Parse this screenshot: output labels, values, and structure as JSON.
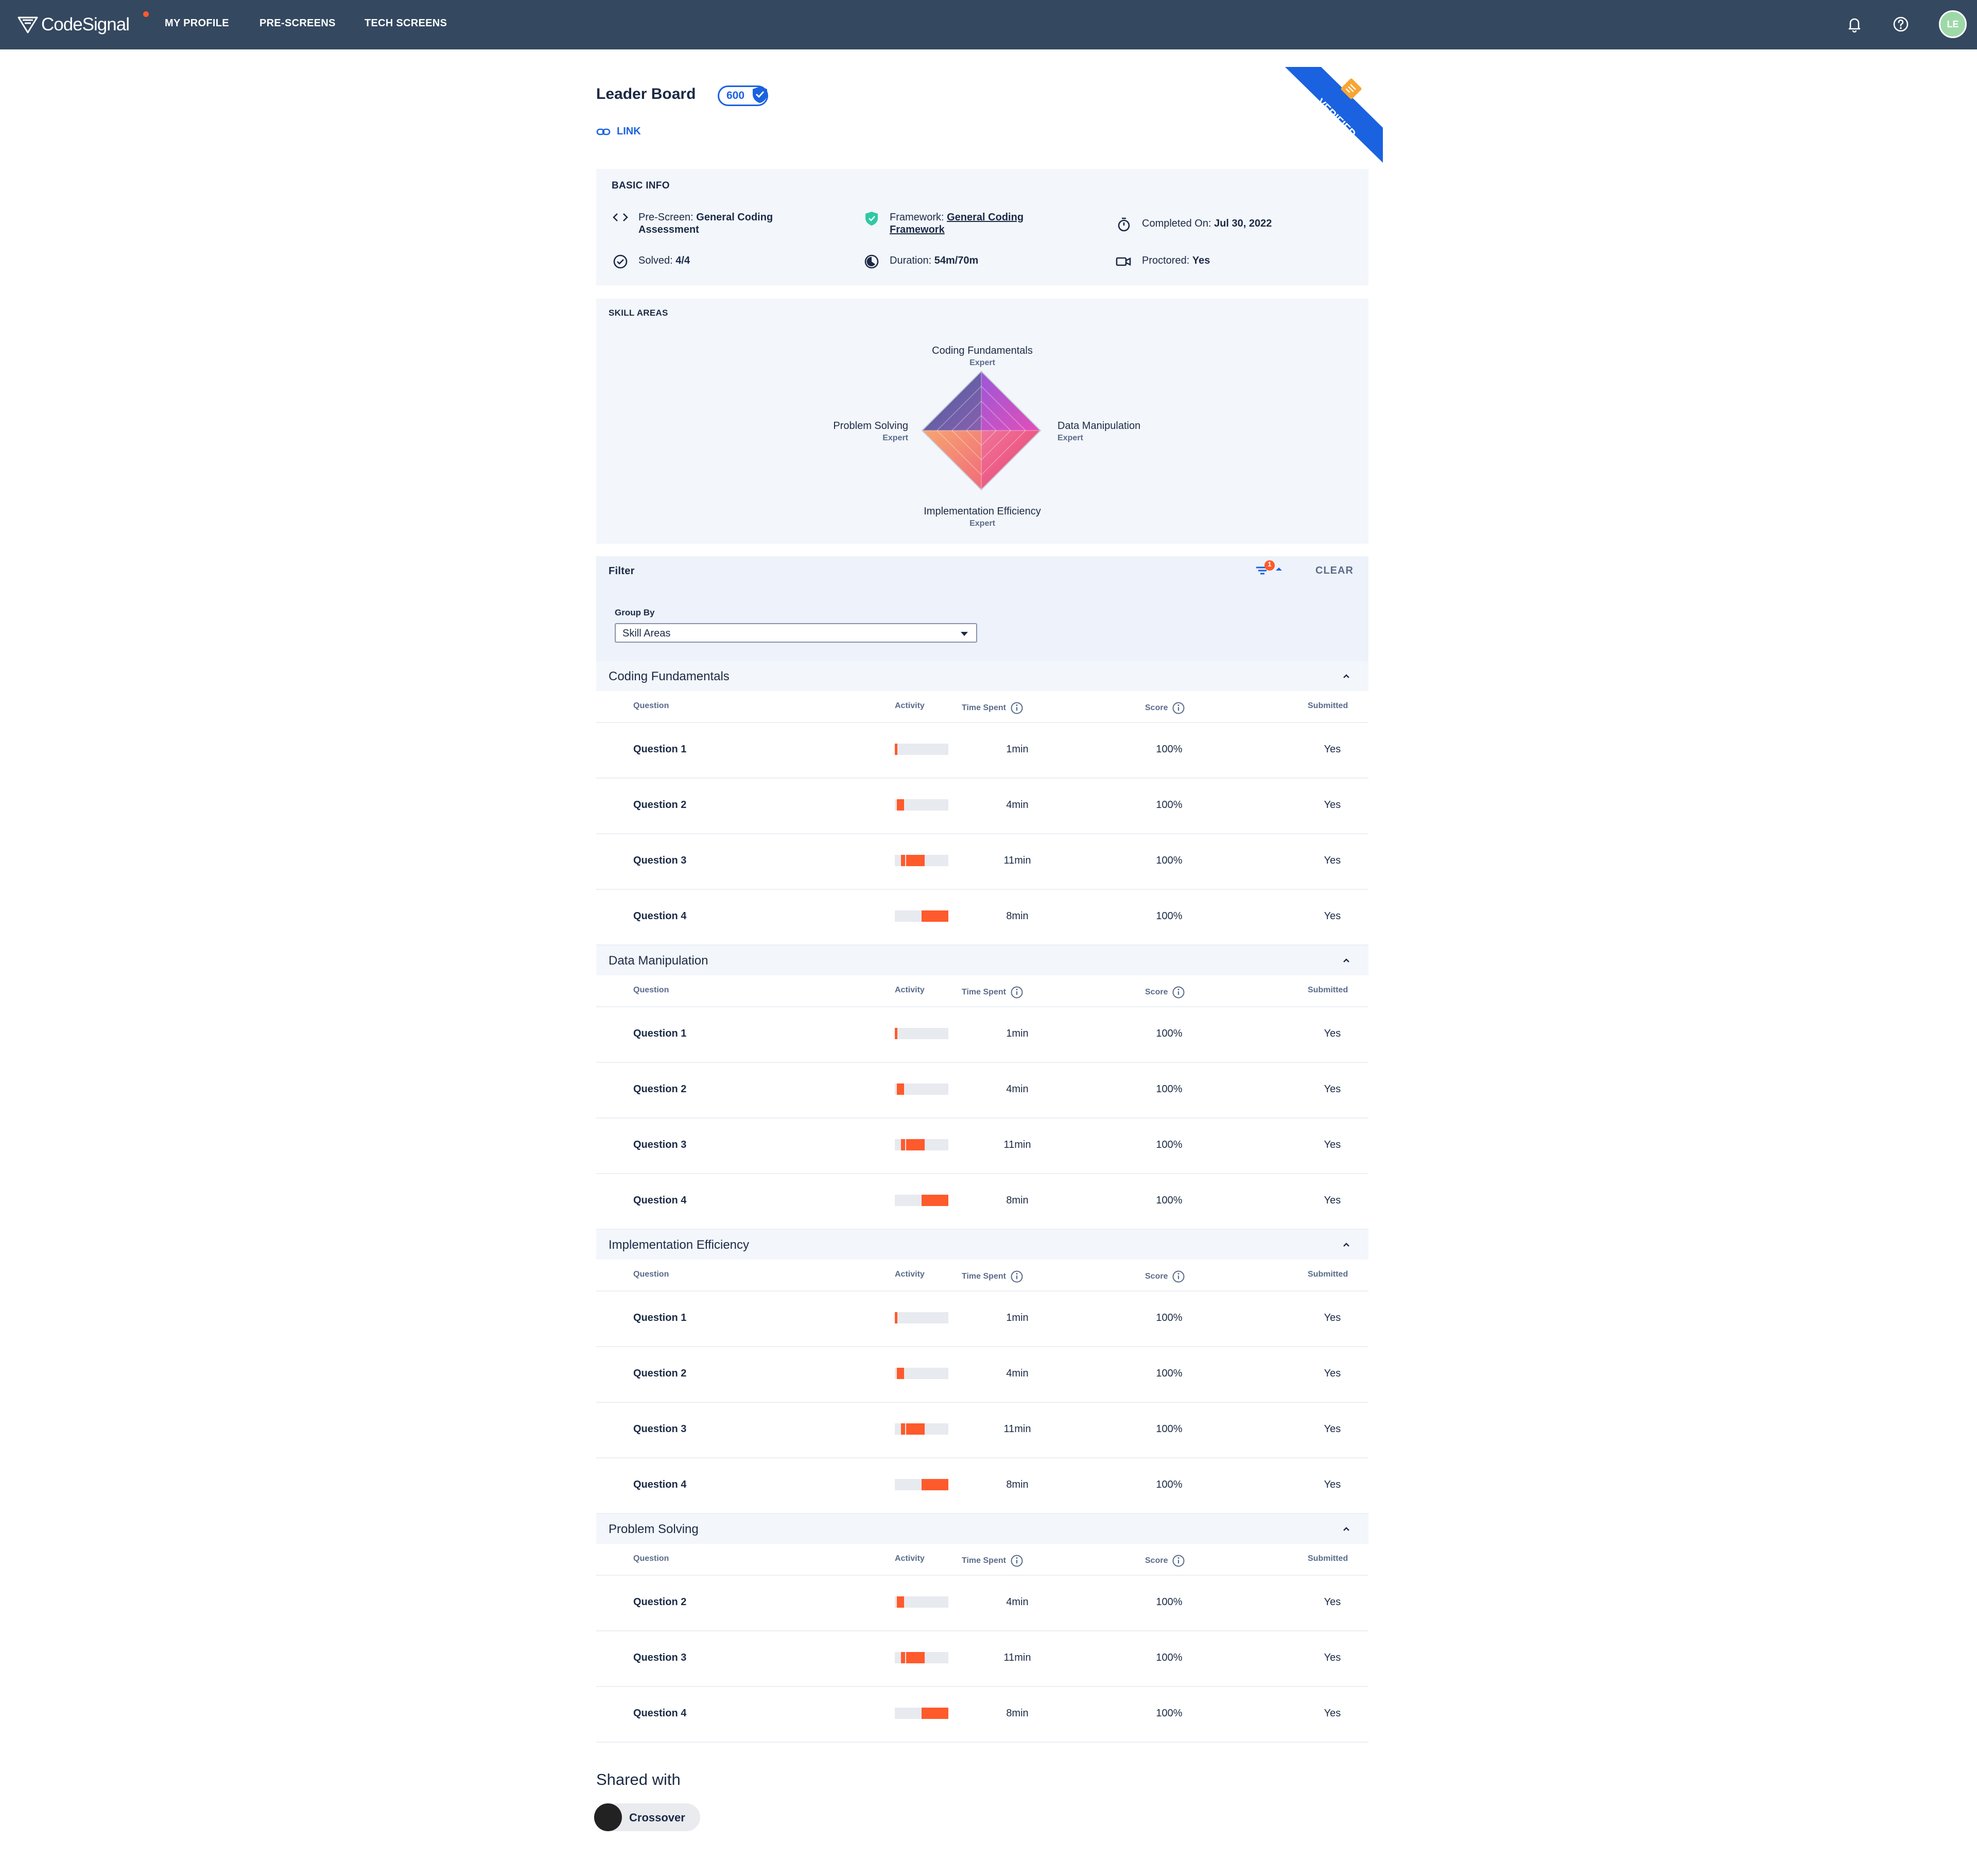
{
  "nav": {
    "logo": "CodeSignal",
    "items": [
      "MY PROFILE",
      "PRE-SCREENS",
      "TECH SCREENS"
    ],
    "user_initials": "LE"
  },
  "header": {
    "title": "Leader Board",
    "score": "600",
    "link_label": "LINK",
    "ribbon": "VERIFIED"
  },
  "basic_info": {
    "title": "BASIC INFO",
    "prescreen_label": "Pre-Screen: ",
    "prescreen_value_line1": "General Coding",
    "prescreen_value_line2": "Assessment",
    "framework_label": "Framework: ",
    "framework_value_line1": "General Coding",
    "framework_value_line2": "Framework",
    "completed_label": "Completed On: ",
    "completed_value": "Jul 30, 2022",
    "solved_label": "Solved: ",
    "solved_value": "4/4",
    "duration_label": "Duration: ",
    "duration_value": "54m/70m",
    "proctored_label": "Proctored: ",
    "proctored_value": "Yes"
  },
  "skill_areas": {
    "title": "SKILL AREAS",
    "axes": [
      {
        "name": "Coding Fundamentals",
        "level": "Expert"
      },
      {
        "name": "Data Manipulation",
        "level": "Expert"
      },
      {
        "name": "Implementation Efficiency",
        "level": "Expert"
      },
      {
        "name": "Problem Solving",
        "level": "Expert"
      }
    ]
  },
  "filter": {
    "title": "Filter",
    "badge_count": "1",
    "clear_label": "CLEAR",
    "group_by_label": "Group By",
    "group_by_value": "Skill Areas"
  },
  "columns": {
    "question": "Question",
    "activity": "Activity",
    "time_spent": "Time Spent",
    "score": "Score",
    "submitted": "Submitted"
  },
  "groups": [
    {
      "title": "Coding Fundamentals",
      "rows": [
        {
          "question": "Question 1",
          "time": "1min",
          "score": "100%",
          "submitted": "Yes"
        },
        {
          "question": "Question 2",
          "time": "4min",
          "score": "100%",
          "submitted": "Yes"
        },
        {
          "question": "Question 3",
          "time": "11min",
          "score": "100%",
          "submitted": "Yes"
        },
        {
          "question": "Question 4",
          "time": "8min",
          "score": "100%",
          "submitted": "Yes"
        }
      ]
    },
    {
      "title": "Data Manipulation",
      "rows": [
        {
          "question": "Question 1",
          "time": "1min",
          "score": "100%",
          "submitted": "Yes"
        },
        {
          "question": "Question 2",
          "time": "4min",
          "score": "100%",
          "submitted": "Yes"
        },
        {
          "question": "Question 3",
          "time": "11min",
          "score": "100%",
          "submitted": "Yes"
        },
        {
          "question": "Question 4",
          "time": "8min",
          "score": "100%",
          "submitted": "Yes"
        }
      ]
    },
    {
      "title": "Implementation Efficiency",
      "rows": [
        {
          "question": "Question 1",
          "time": "1min",
          "score": "100%",
          "submitted": "Yes"
        },
        {
          "question": "Question 2",
          "time": "4min",
          "score": "100%",
          "submitted": "Yes"
        },
        {
          "question": "Question 3",
          "time": "11min",
          "score": "100%",
          "submitted": "Yes"
        },
        {
          "question": "Question 4",
          "time": "8min",
          "score": "100%",
          "submitted": "Yes"
        }
      ]
    },
    {
      "title": "Problem Solving",
      "rows": [
        {
          "question": "Question 2",
          "time": "4min",
          "score": "100%",
          "submitted": "Yes"
        },
        {
          "question": "Question 3",
          "time": "11min",
          "score": "100%",
          "submitted": "Yes"
        },
        {
          "question": "Question 4",
          "time": "8min",
          "score": "100%",
          "submitted": "Yes"
        }
      ]
    }
  ],
  "shared": {
    "title": "Shared with",
    "company": "Crossover"
  },
  "colors": {
    "nav_bg": "#344860",
    "accent": "#1a62e0",
    "activity": "#ff5a2b",
    "panel_bg": "#f3f6fb"
  }
}
